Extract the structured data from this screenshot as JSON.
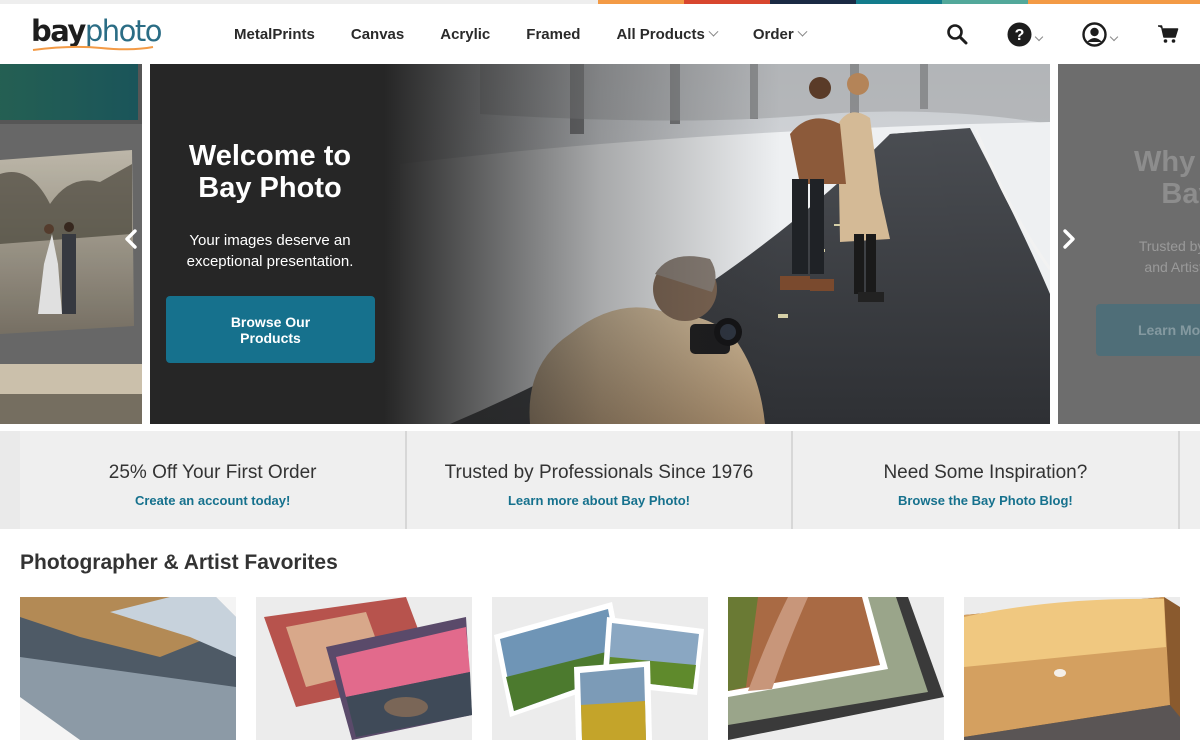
{
  "brand": {
    "logo_bay": "bay",
    "logo_photo": "photo",
    "stripe_colors": [
      "#eeeeee",
      "#f39a45",
      "#d8462e",
      "#1a2a44",
      "#137c8c",
      "#52a89a",
      "#f39a45"
    ]
  },
  "nav": {
    "items": [
      {
        "label": "MetalPrints",
        "dropdown": false
      },
      {
        "label": "Canvas",
        "dropdown": false
      },
      {
        "label": "Acrylic",
        "dropdown": false
      },
      {
        "label": "Framed",
        "dropdown": false
      },
      {
        "label": "All Products",
        "dropdown": true
      },
      {
        "label": "Order",
        "dropdown": true
      }
    ],
    "icons": [
      "search-icon",
      "help-icon",
      "account-icon",
      "cart-icon"
    ]
  },
  "hero": {
    "title": "Welcome to Bay Photo",
    "tagline": "Your images deserve an exceptional presentation.",
    "cta_label": "Browse Our Products",
    "next_slide_title": "Why Ch... Bay",
    "next_slide_title_line1": "Why Ch",
    "next_slide_title_line2": "Bay",
    "next_slide_sub_line1": "Trusted by Phot",
    "next_slide_sub_line2": "and Artists sin",
    "next_slide_button": "Learn Mo"
  },
  "promos": [
    {
      "title": "25% Off Your First Order",
      "link": "Create an account today!"
    },
    {
      "title": "Trusted by Professionals Since 1976",
      "link": "Learn more about Bay Photo!"
    },
    {
      "title": "Need Some Inspiration?",
      "link": "Browse the Bay Photo Blog!"
    }
  ],
  "favorites": {
    "title": "Photographer & Artist Favorites",
    "items": [
      "metal-print-image",
      "acrylic-print-image",
      "photo-prints-image",
      "framed-print-image",
      "canvas-print-image"
    ]
  },
  "colors": {
    "accent": "#16718d",
    "promo_bg": "#efefef"
  }
}
